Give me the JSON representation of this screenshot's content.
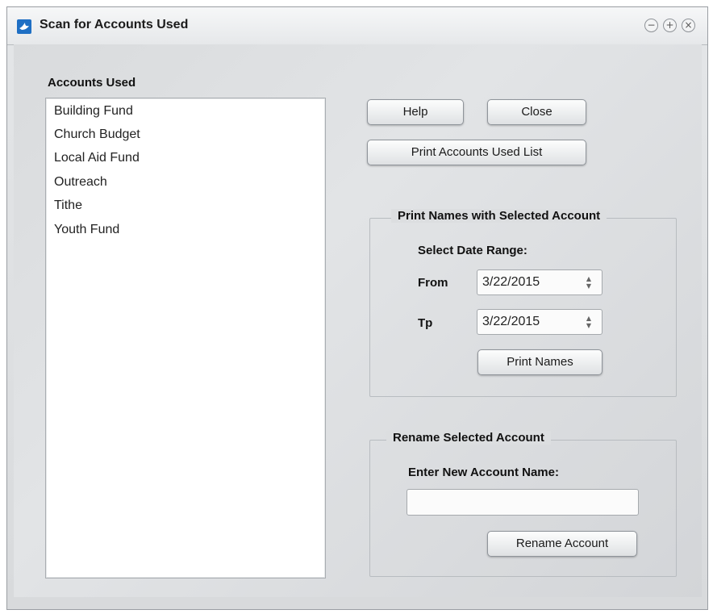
{
  "window": {
    "title": "Scan for Accounts Used",
    "controls": {
      "minimize": "−",
      "maximize": "+",
      "close": "×"
    }
  },
  "accounts": {
    "heading": "Accounts Used",
    "items": [
      "Building Fund",
      "Church Budget",
      "Local Aid Fund",
      "Outreach",
      "Tithe",
      "Youth Fund"
    ]
  },
  "buttons": {
    "help": "Help",
    "close": "Close",
    "print_list": "Print Accounts Used List"
  },
  "print_names": {
    "group_title": "Print Names with Selected Account",
    "date_range_label": "Select Date Range:",
    "from_label": "From",
    "from_value": "3/22/2015",
    "to_label": "Tp",
    "to_value": "3/22/2015",
    "button": "Print Names"
  },
  "rename": {
    "group_title": "Rename Selected Account",
    "prompt": "Enter New Account Name:",
    "input_value": "",
    "button": "Rename Account"
  },
  "colors": {
    "app_icon": "#1e6fc4",
    "list_background": "#ffffff",
    "panel": "#dcdee0"
  },
  "icons": {
    "app": "dove-icon",
    "minimize": "minimize-icon",
    "maximize": "maximize-icon",
    "close": "close-icon",
    "spinner": "spinner-arrows-icon"
  }
}
